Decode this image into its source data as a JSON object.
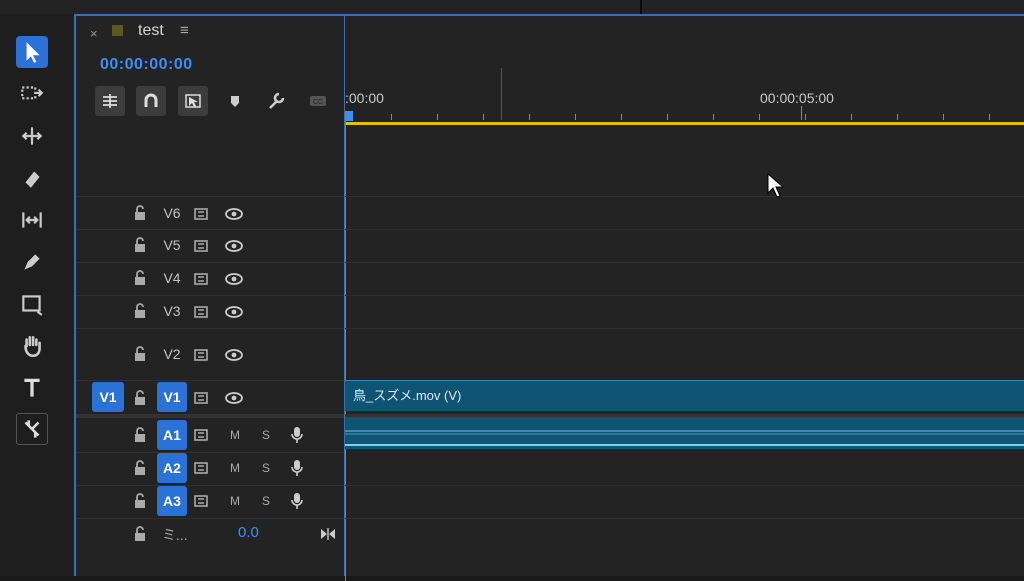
{
  "panel": {
    "tab": {
      "close": "×",
      "title": "test",
      "menu": "≡"
    },
    "timecode": "00:00:00:00"
  },
  "ruler": {
    "t0": ":00:00",
    "t5": "00:00:05:00"
  },
  "tracks": {
    "video": [
      {
        "label": "V6"
      },
      {
        "label": "V5"
      },
      {
        "label": "V4"
      },
      {
        "label": "V3"
      },
      {
        "label": "V2"
      },
      {
        "label": "V1",
        "source": "V1"
      }
    ],
    "audio": [
      {
        "label": "A1",
        "m": "M",
        "s": "S"
      },
      {
        "label": "A2",
        "m": "M",
        "s": "S"
      },
      {
        "label": "A3",
        "m": "M",
        "s": "S"
      }
    ],
    "mix": {
      "label": "ミ...",
      "value": "0.0"
    }
  },
  "clips": {
    "video_name": "鳥_スズメ.mov (V)"
  },
  "colors": {
    "accent": "#2a72d8",
    "workarea": "#e0c400",
    "clip": "#0f5473"
  }
}
